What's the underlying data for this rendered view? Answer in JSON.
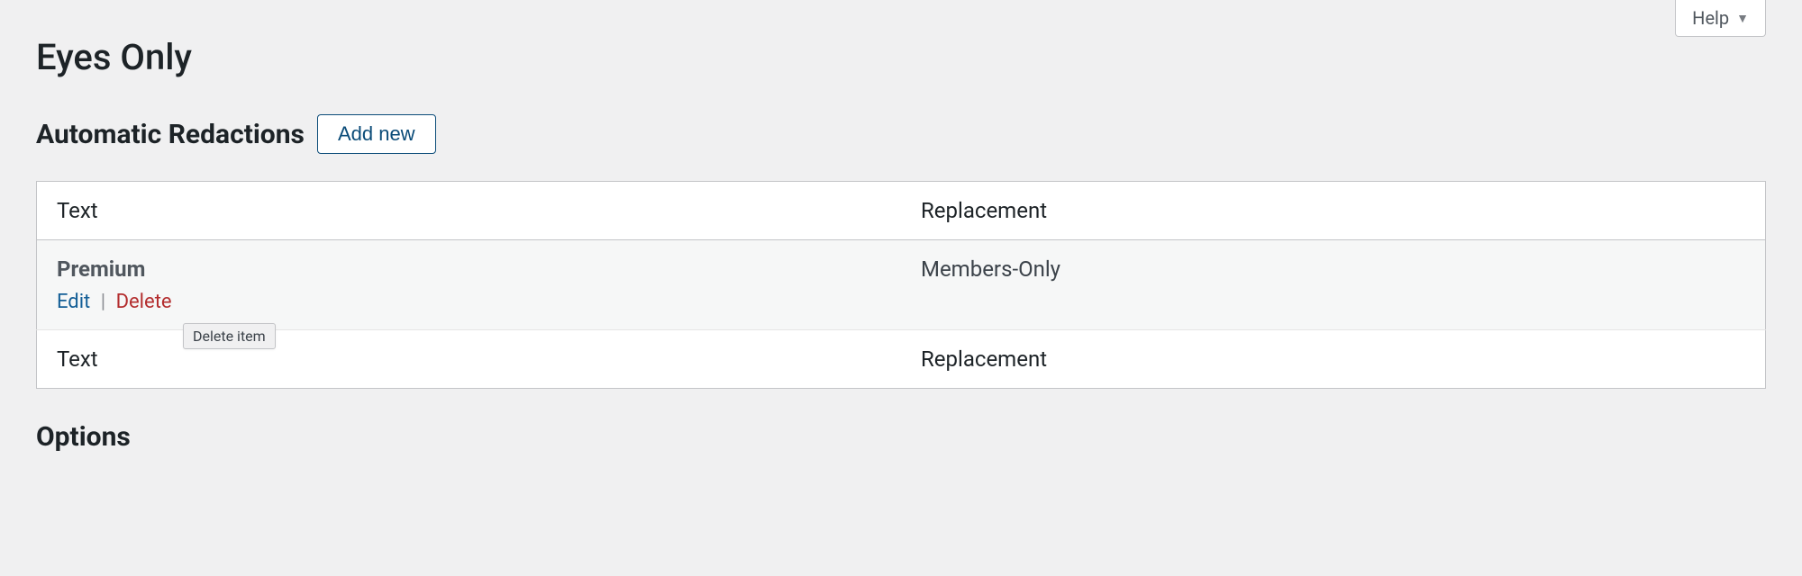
{
  "help": {
    "label": "Help"
  },
  "page": {
    "title": "Eyes Only"
  },
  "redactions": {
    "heading": "Automatic Redactions",
    "add_new_label": "Add new",
    "columns": {
      "text": "Text",
      "replacement": "Replacement"
    },
    "rows": [
      {
        "text": "Premium",
        "replacement": "Members-Only",
        "actions": {
          "edit": "Edit",
          "sep": "|",
          "delete": "Delete",
          "tooltip": "Delete item"
        }
      }
    ]
  },
  "options": {
    "heading": "Options"
  }
}
